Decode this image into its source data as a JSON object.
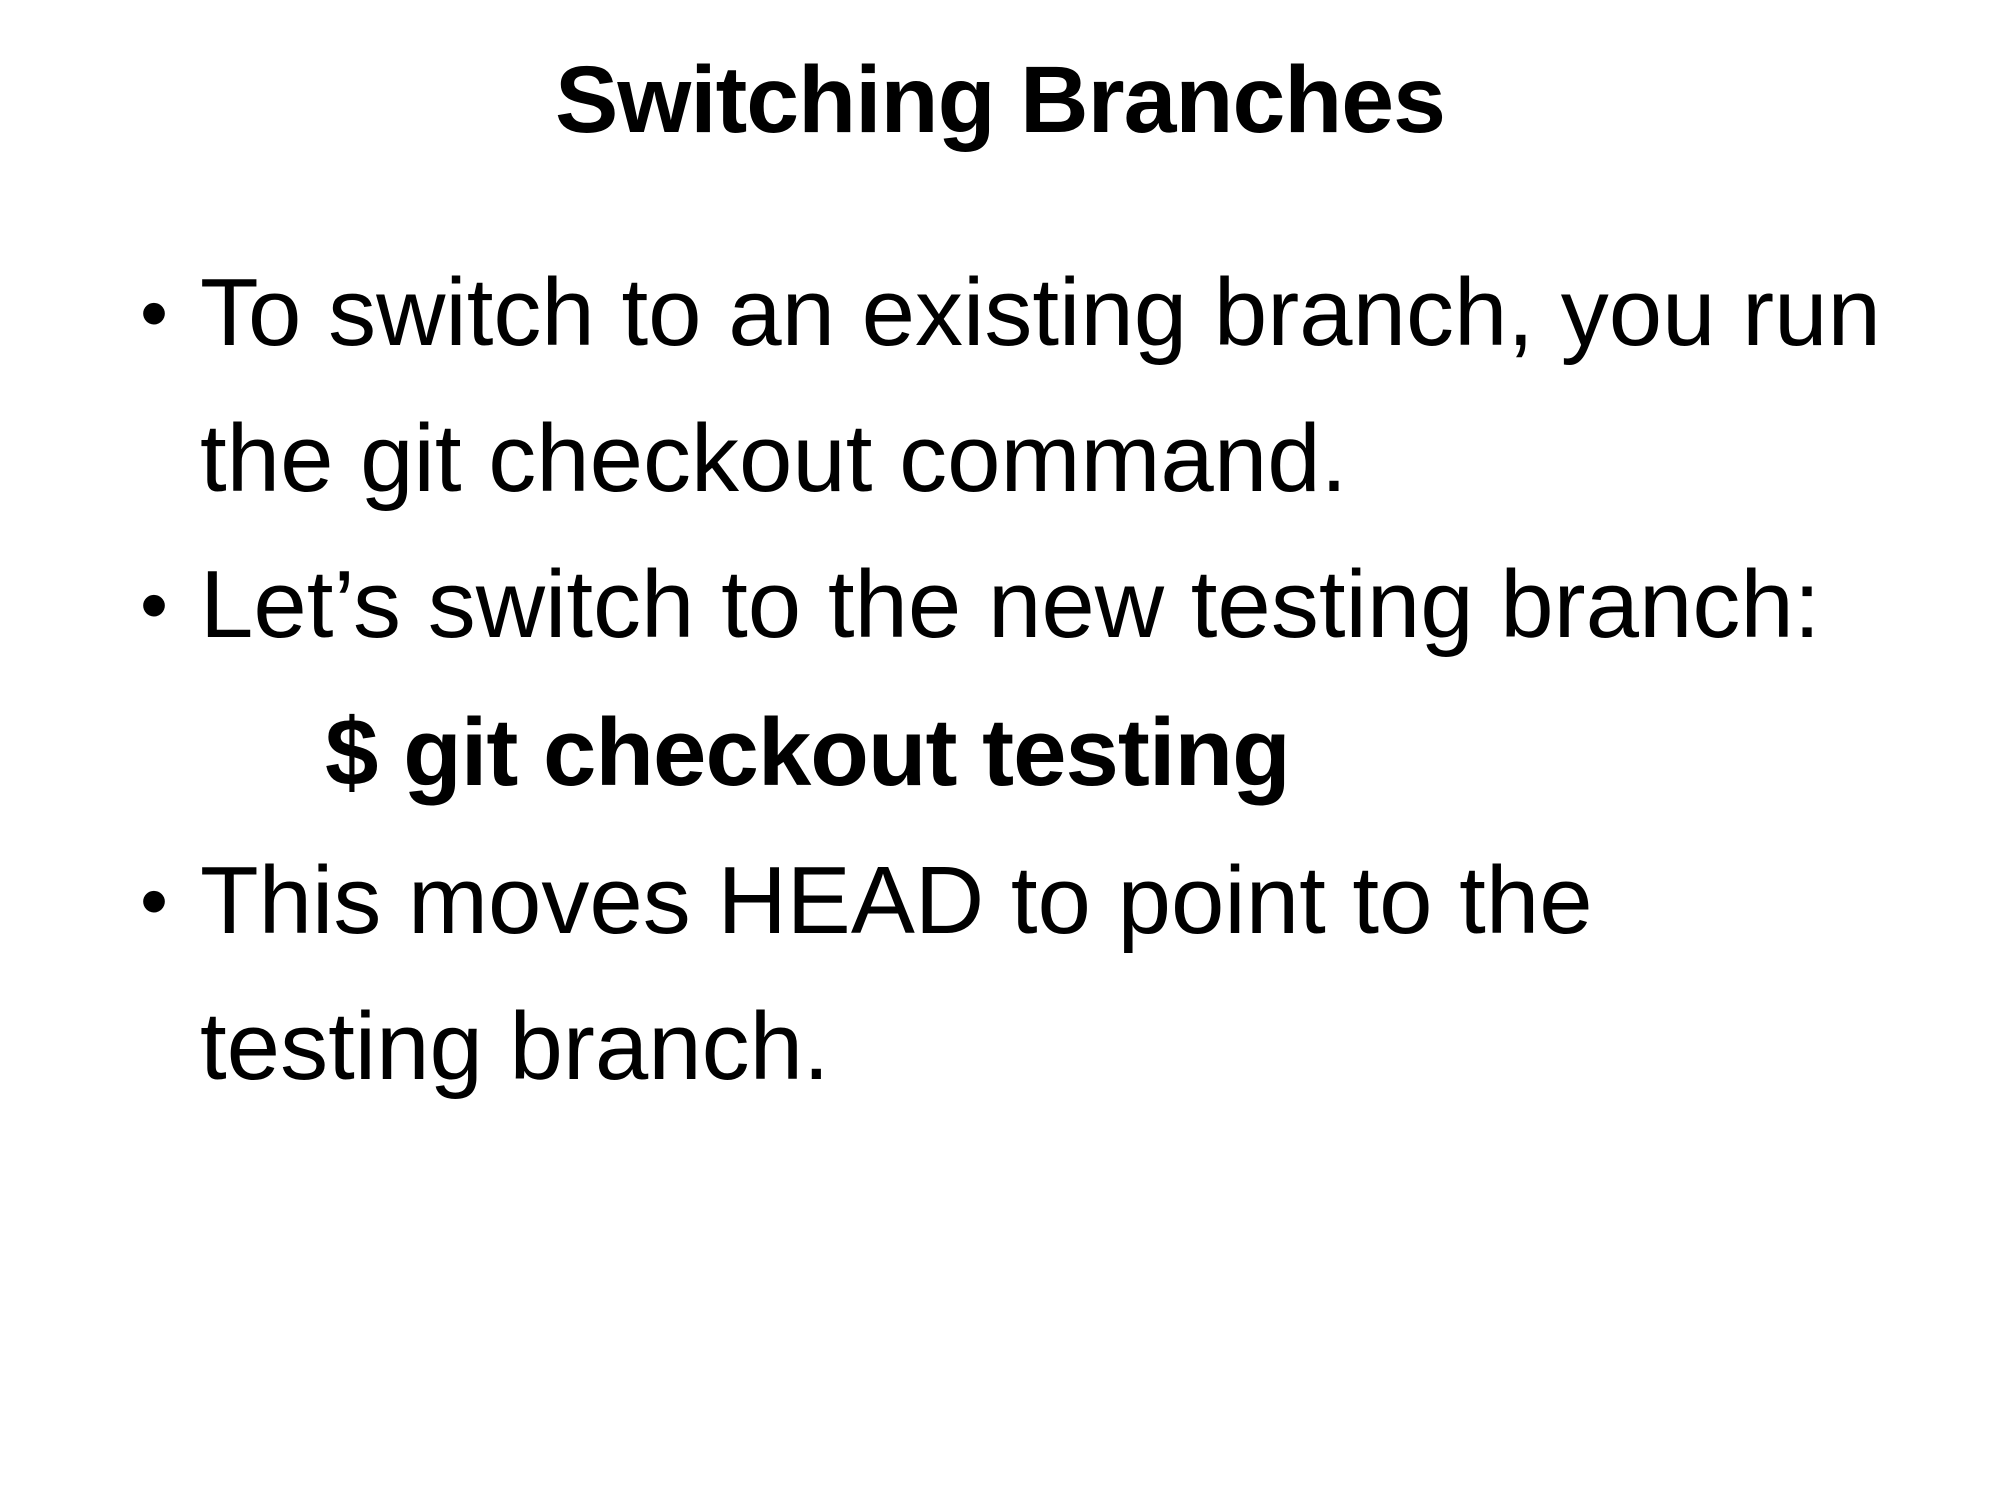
{
  "slide": {
    "title": "Switching Branches",
    "bullet_symbol": "•",
    "bullets": [
      "To switch to an existing branch, you run the git checkout command.",
      "Let’s switch to the new testing branch:",
      "This moves HEAD to point to the testing branch."
    ],
    "command": "$ git checkout testing"
  }
}
